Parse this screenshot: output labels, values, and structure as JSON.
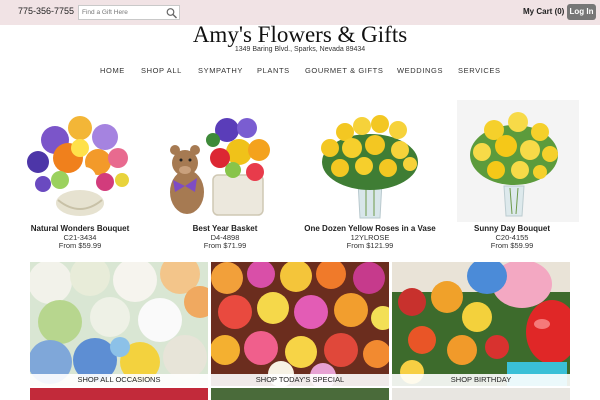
{
  "topbar": {
    "phone": "775-356-7755",
    "search_placeholder": "Find a Gift Here",
    "search_icon": "search-icon",
    "cart": "My Cart (0)",
    "login": "Log In"
  },
  "header": {
    "title": "Amy's Flowers & Gifts",
    "address": "1349 Baring Blvd., Sparks, Nevada 89434"
  },
  "nav": [
    "HOME",
    "SHOP ALL",
    "SYMPATHY",
    "PLANTS",
    "GOURMET & GIFTS",
    "WEDDINGS",
    "SERVICES"
  ],
  "products": [
    {
      "name": "Natural Wonders Bouquet",
      "code": "C21-3434",
      "price": "From $59.99"
    },
    {
      "name": "Best Year Basket",
      "code": "D4-4898",
      "price": "From $71.99"
    },
    {
      "name": "One Dozen Yellow Roses in a Vase",
      "code": "12YLROSE",
      "price": "From $121.99"
    },
    {
      "name": "Sunny Day Bouquet",
      "code": "C20-4155",
      "price": "From $59.99"
    }
  ],
  "categories": [
    {
      "label": "SHOP ALL OCCASIONS"
    },
    {
      "label": "SHOP TODAY'S SPECIAL"
    },
    {
      "label": "SHOP BIRTHDAY"
    }
  ],
  "colors": {
    "topbar": "#f1e3e5",
    "login_button": "#777777"
  }
}
